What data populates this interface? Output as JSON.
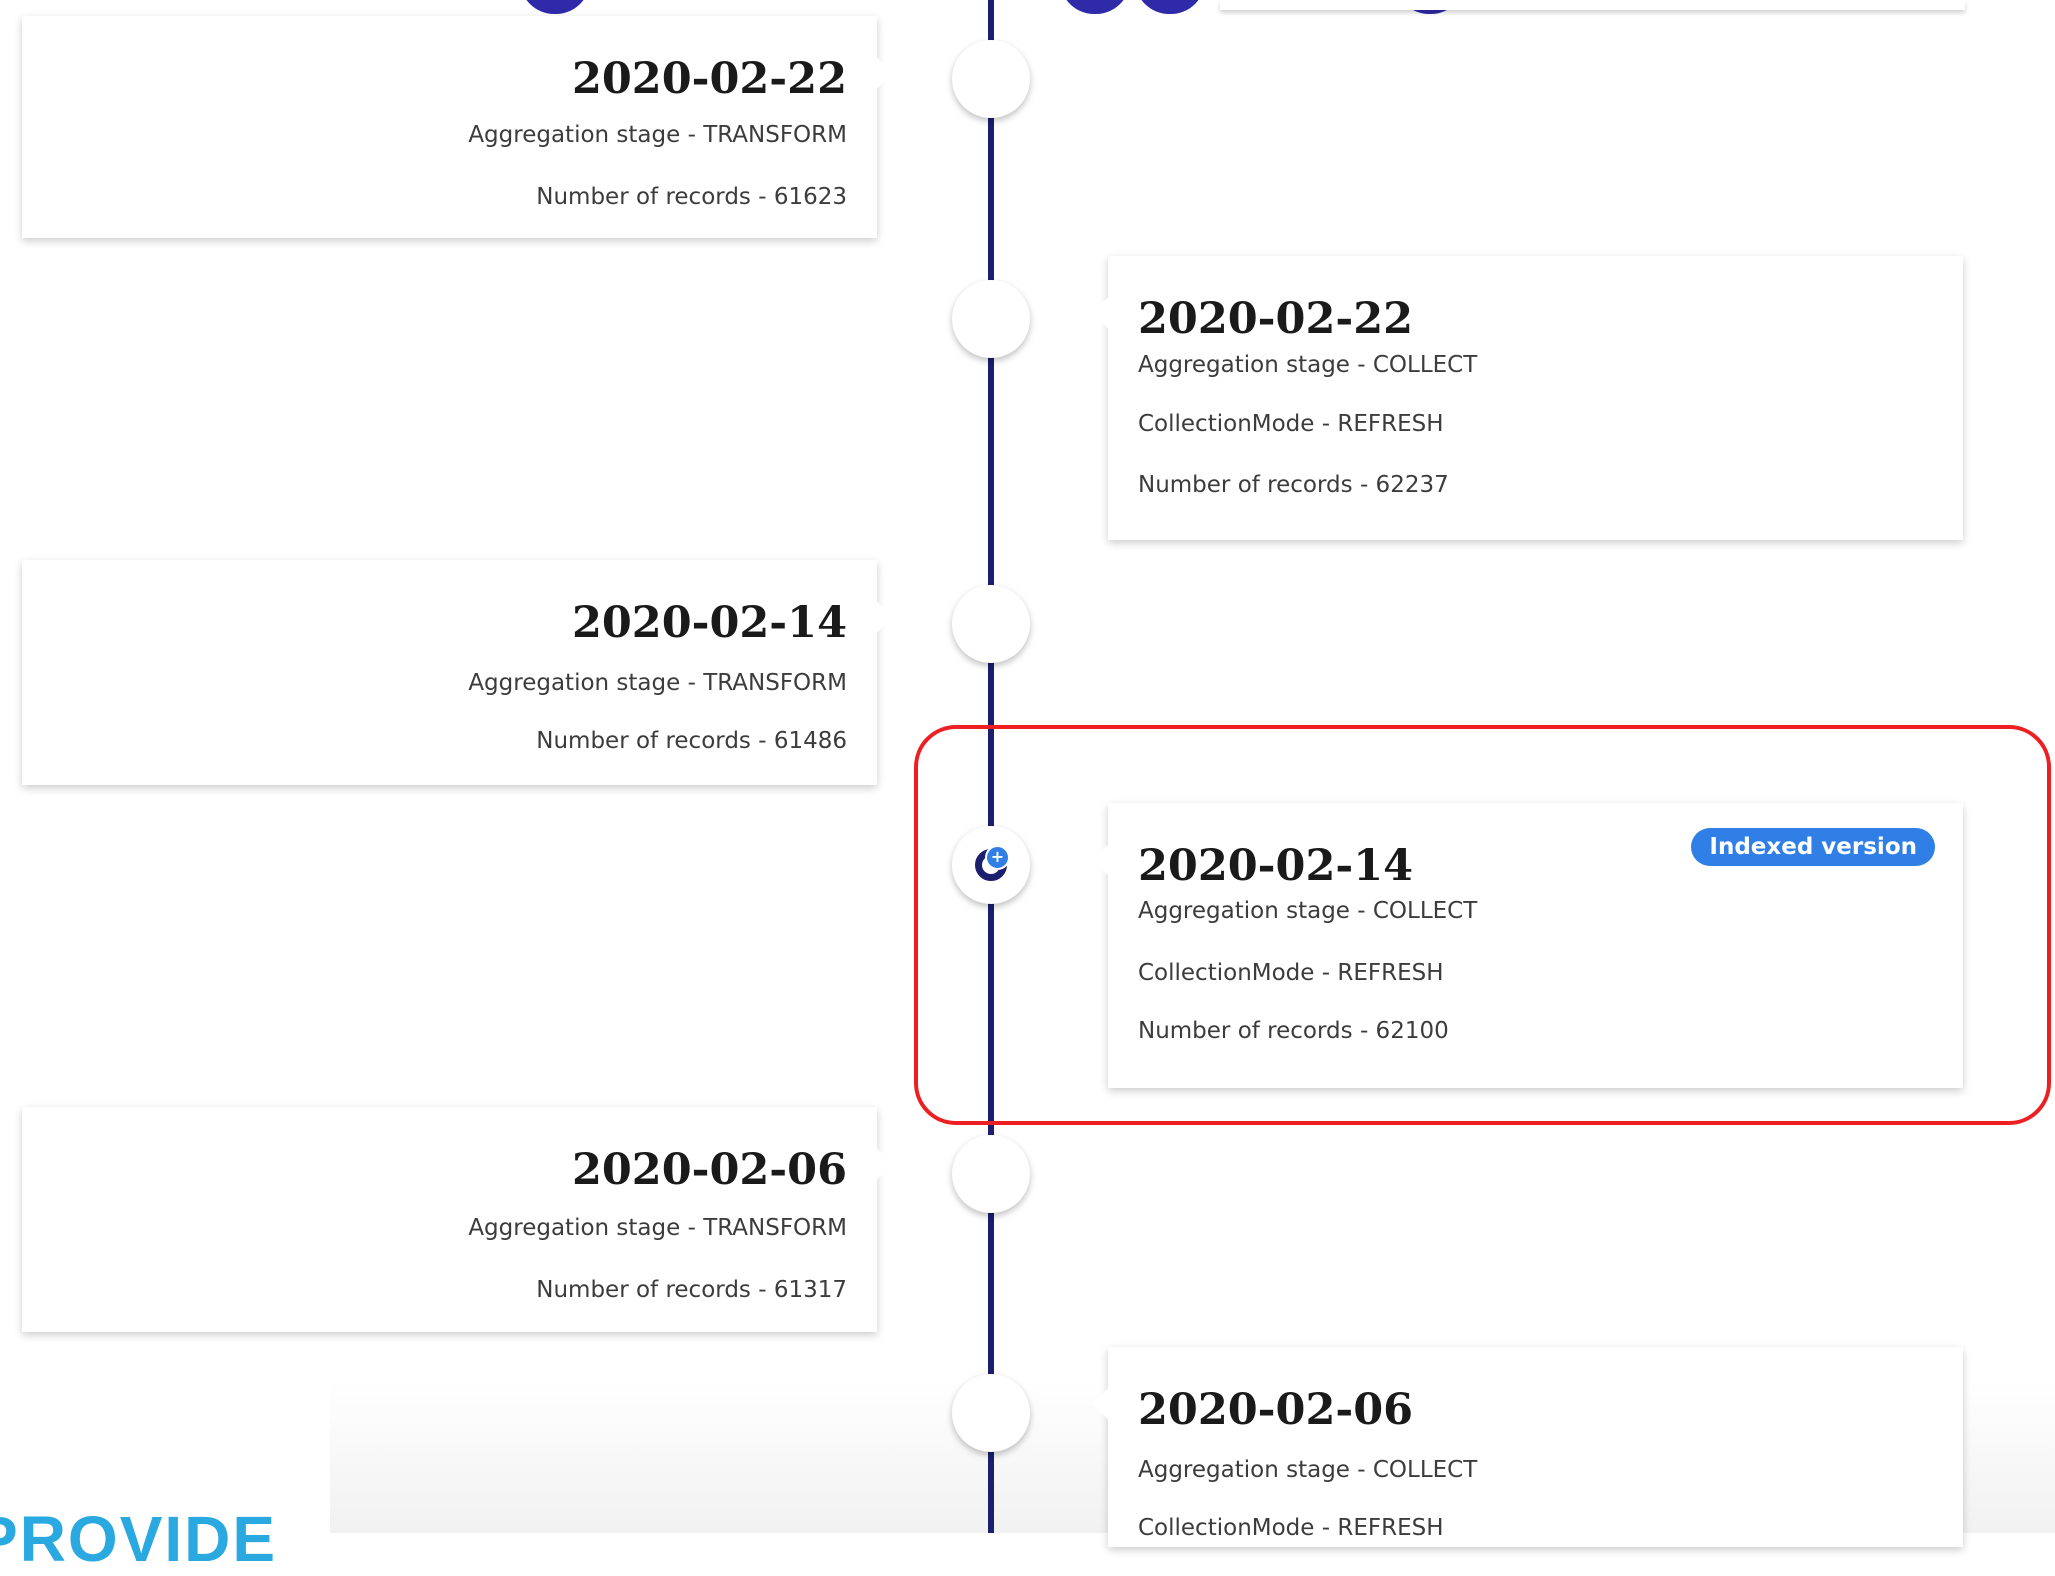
{
  "timeline": {
    "entries": [
      {
        "date": "2020-02-22",
        "lines": [
          "Aggregation stage - TRANSFORM",
          "Number of records - 61623"
        ]
      },
      {
        "date": "2020-02-22",
        "lines": [
          "Aggregation stage - COLLECT",
          "CollectionMode - REFRESH",
          "Number of records - 62237"
        ]
      },
      {
        "date": "2020-02-14",
        "lines": [
          "Aggregation stage - TRANSFORM",
          "Number of records - 61486"
        ]
      },
      {
        "date": "2020-02-14",
        "badge": "Indexed version",
        "lines": [
          "Aggregation stage - COLLECT",
          "CollectionMode - REFRESH",
          "Number of records - 62100"
        ]
      },
      {
        "date": "2020-02-06",
        "lines": [
          "Aggregation stage - TRANSFORM",
          "Number of records - 61317"
        ]
      },
      {
        "date": "2020-02-06",
        "lines": [
          "Aggregation stage - COLLECT",
          "CollectionMode - REFRESH"
        ]
      }
    ]
  },
  "indexed_icon": {
    "plus": "+"
  },
  "logo": {
    "text": "PROVIDE"
  },
  "colors": {
    "timeline_line": "#1b1f6e",
    "badge": "#2f7fe6",
    "highlight": "#ee1f22",
    "logo": "#2aa8e0",
    "header_glyph": "#2f2aa8"
  },
  "icons": {
    "indexed_node": "indexed-version-icon"
  }
}
